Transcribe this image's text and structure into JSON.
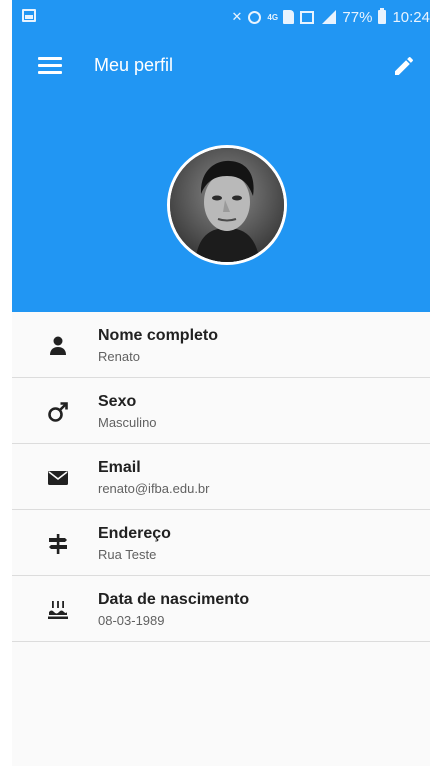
{
  "status_bar": {
    "battery": "77%",
    "time": "10:24",
    "network": "4G"
  },
  "toolbar": {
    "title": "Meu perfil",
    "menu_icon": "hamburger-menu-icon",
    "edit_icon": "pencil-edit-icon"
  },
  "profile": {
    "avatar_icon": "profile-photo"
  },
  "fields": [
    {
      "label": "Nome completo",
      "value": "Renato",
      "icon": "person-icon"
    },
    {
      "label": "Sexo",
      "value": "Masculino",
      "icon": "male-symbol-icon"
    },
    {
      "label": "Email",
      "value": "renato@ifba.edu.br",
      "icon": "envelope-icon"
    },
    {
      "label": "Endereço",
      "value": "Rua Teste",
      "icon": "signpost-icon"
    },
    {
      "label": "Data de nascimento",
      "value": "08-03-1989",
      "icon": "birthday-cake-icon"
    }
  ],
  "colors": {
    "primary": "#2196f3",
    "text_primary": "#212121",
    "text_secondary": "#616161"
  }
}
